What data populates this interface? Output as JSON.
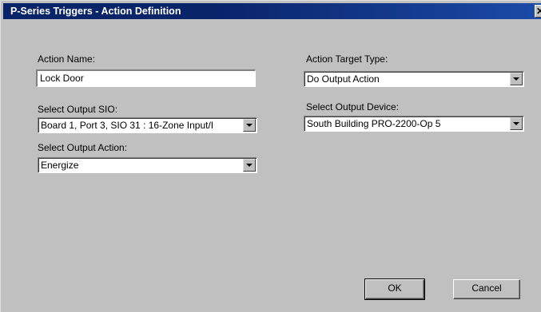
{
  "window": {
    "title": "P-Series Triggers - Action Definition",
    "close_glyph": "✕"
  },
  "form": {
    "action_name_label": "Action Name:",
    "action_name_value": "Lock Door",
    "select_output_sio_label": "Select Output SIO:",
    "select_output_sio_value": "Board 1, Port 3, SIO 31 : 16-Zone Input/I",
    "select_output_action_label": "Select Output Action:",
    "select_output_action_value": "Energize",
    "action_target_type_label": "Action Target Type:",
    "action_target_type_value": "Do Output Action",
    "select_output_device_label": "Select Output Device:",
    "select_output_device_value": "South Building PRO-2200-Op 5"
  },
  "buttons": {
    "ok_label": "OK",
    "cancel_label": "Cancel"
  },
  "icons": {
    "dropdown_arrow": "chevron-down-icon",
    "close": "close-icon"
  },
  "colors": {
    "titlebar": "#0a246a",
    "dialog_face": "#c0c0c0"
  }
}
